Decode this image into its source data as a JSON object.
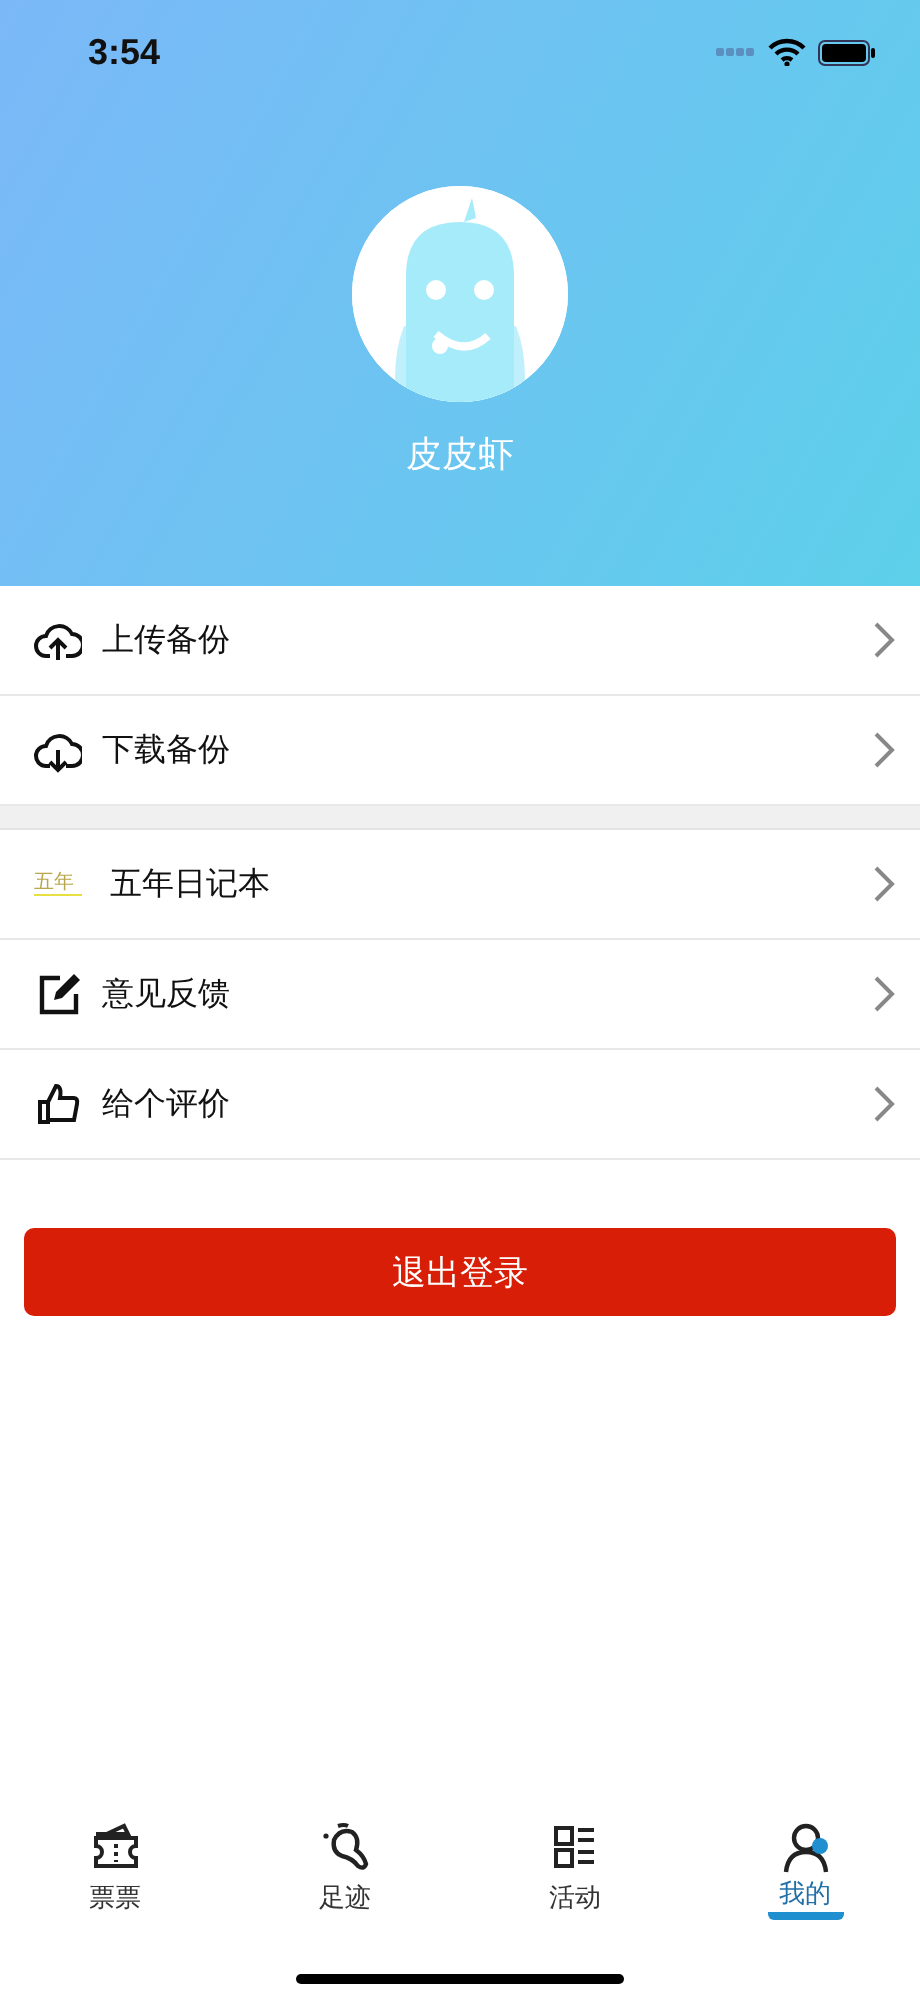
{
  "status_bar": {
    "time": "3:54"
  },
  "profile": {
    "name": "皮皮虾"
  },
  "menu_groups": [
    {
      "items": [
        {
          "kind": "upload",
          "label": "上传备份"
        },
        {
          "kind": "download",
          "label": "下载备份"
        }
      ]
    },
    {
      "items": [
        {
          "kind": "logo",
          "logo_text": "五年",
          "label": "五年日记本"
        },
        {
          "kind": "edit",
          "label": "意见反馈"
        },
        {
          "kind": "like",
          "label": "给个评价"
        }
      ]
    }
  ],
  "logout_button": "退出登录",
  "tabs": [
    {
      "kind": "ticket",
      "label": "票票",
      "selected": false
    },
    {
      "kind": "footprint",
      "label": "足迹",
      "selected": false
    },
    {
      "kind": "list",
      "label": "活动",
      "selected": false
    },
    {
      "kind": "person",
      "label": "我的",
      "selected": true
    }
  ]
}
